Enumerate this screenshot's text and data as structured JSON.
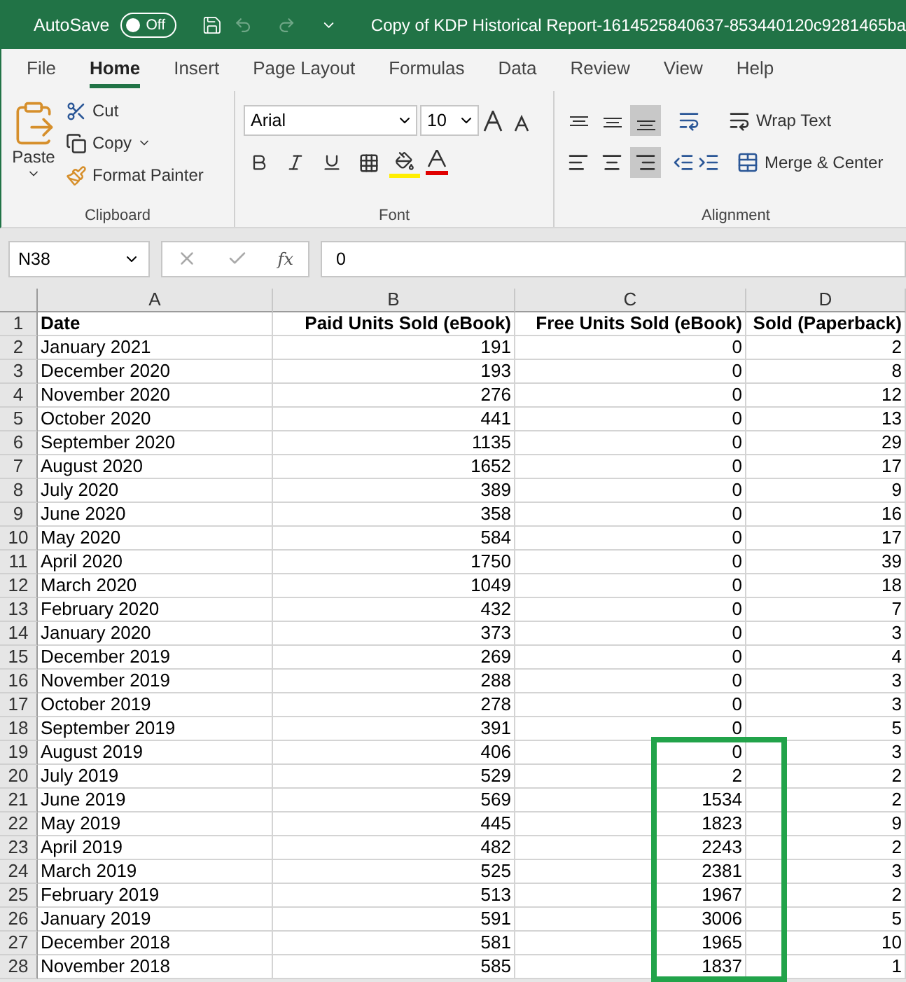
{
  "title_bar": {
    "autosave_label": "AutoSave",
    "autosave_toggle": {
      "label": "Off",
      "on": false
    },
    "document_title": "Copy of KDP Historical Report-1614525840637-853440120c9281465ba"
  },
  "menu_tabs": [
    {
      "label": "File",
      "selected": false
    },
    {
      "label": "Home",
      "selected": true
    },
    {
      "label": "Insert",
      "selected": false
    },
    {
      "label": "Page Layout",
      "selected": false
    },
    {
      "label": "Formulas",
      "selected": false
    },
    {
      "label": "Data",
      "selected": false
    },
    {
      "label": "Review",
      "selected": false
    },
    {
      "label": "View",
      "selected": false
    },
    {
      "label": "Help",
      "selected": false
    }
  ],
  "ribbon": {
    "clipboard": {
      "paste": "Paste",
      "cut": "Cut",
      "copy": "Copy",
      "format_painter": "Format Painter",
      "label": "Clipboard"
    },
    "font": {
      "font_name": "Arial",
      "font_size": "10",
      "label": "Font"
    },
    "alignment": {
      "vertical": [
        {
          "kind": "top",
          "selected": false
        },
        {
          "kind": "middle",
          "selected": false
        },
        {
          "kind": "bottom",
          "selected": true
        }
      ],
      "horizontal": [
        {
          "kind": "left",
          "selected": false
        },
        {
          "kind": "center",
          "selected": false
        },
        {
          "kind": "right",
          "selected": true
        }
      ],
      "wrap_text": "Wrap Text",
      "merge_center": "Merge & Center",
      "label": "Alignment"
    }
  },
  "formula_bar": {
    "name_box": "N38",
    "function_label": "fx",
    "value": "0"
  },
  "columns": [
    "A",
    "B",
    "C",
    "D"
  ],
  "header_row": {
    "n": "1",
    "cells": [
      "Date",
      "Paid Units Sold (eBook)",
      "Free Units Sold (eBook)",
      "Sold (Paperback)"
    ]
  },
  "rows": [
    {
      "n": "2",
      "cells": [
        "January 2021",
        "191",
        "0",
        "2"
      ],
      "highlighted": false
    },
    {
      "n": "3",
      "cells": [
        "December 2020",
        "193",
        "0",
        "8"
      ],
      "highlighted": false
    },
    {
      "n": "4",
      "cells": [
        "November 2020",
        "276",
        "0",
        "12"
      ],
      "highlighted": false
    },
    {
      "n": "5",
      "cells": [
        "October 2020",
        "441",
        "0",
        "13"
      ],
      "highlighted": false
    },
    {
      "n": "6",
      "cells": [
        "September 2020",
        "1135",
        "0",
        "29"
      ],
      "highlighted": false
    },
    {
      "n": "7",
      "cells": [
        "August 2020",
        "1652",
        "0",
        "17"
      ],
      "highlighted": false
    },
    {
      "n": "8",
      "cells": [
        "July 2020",
        "389",
        "0",
        "9"
      ],
      "highlighted": false
    },
    {
      "n": "9",
      "cells": [
        "June 2020",
        "358",
        "0",
        "16"
      ],
      "highlighted": false
    },
    {
      "n": "10",
      "cells": [
        "May 2020",
        "584",
        "0",
        "17"
      ],
      "highlighted": false
    },
    {
      "n": "11",
      "cells": [
        "April 2020",
        "1750",
        "0",
        "39"
      ],
      "highlighted": false
    },
    {
      "n": "12",
      "cells": [
        "March 2020",
        "1049",
        "0",
        "18"
      ],
      "highlighted": false
    },
    {
      "n": "13",
      "cells": [
        "February 2020",
        "432",
        "0",
        "7"
      ],
      "highlighted": false
    },
    {
      "n": "14",
      "cells": [
        "January 2020",
        "373",
        "0",
        "3"
      ],
      "highlighted": false
    },
    {
      "n": "15",
      "cells": [
        "December 2019",
        "269",
        "0",
        "4"
      ],
      "highlighted": false
    },
    {
      "n": "16",
      "cells": [
        "November 2019",
        "288",
        "0",
        "3"
      ],
      "highlighted": false
    },
    {
      "n": "17",
      "cells": [
        "October 2019",
        "278",
        "0",
        "3"
      ],
      "highlighted": false
    },
    {
      "n": "18",
      "cells": [
        "September 2019",
        "391",
        "0",
        "5"
      ],
      "highlighted": false
    },
    {
      "n": "19",
      "cells": [
        "August 2019",
        "406",
        "0",
        "3"
      ],
      "highlighted": true
    },
    {
      "n": "20",
      "cells": [
        "July 2019",
        "529",
        "2",
        "2"
      ],
      "highlighted": true
    },
    {
      "n": "21",
      "cells": [
        "June 2019",
        "569",
        "1534",
        "2"
      ],
      "highlighted": true
    },
    {
      "n": "22",
      "cells": [
        "May 2019",
        "445",
        "1823",
        "9"
      ],
      "highlighted": true
    },
    {
      "n": "23",
      "cells": [
        "April 2019",
        "482",
        "2243",
        "2"
      ],
      "highlighted": true
    },
    {
      "n": "24",
      "cells": [
        "March 2019",
        "525",
        "2381",
        "3"
      ],
      "highlighted": true
    },
    {
      "n": "25",
      "cells": [
        "February 2019",
        "513",
        "1967",
        "2"
      ],
      "highlighted": true
    },
    {
      "n": "26",
      "cells": [
        "January 2019",
        "591",
        "3006",
        "5"
      ],
      "highlighted": true
    },
    {
      "n": "27",
      "cells": [
        "December 2018",
        "581",
        "1965",
        "10"
      ],
      "highlighted": true
    },
    {
      "n": "28",
      "cells": [
        "November 2018",
        "585",
        "1837",
        "1"
      ],
      "highlighted": true
    }
  ]
}
